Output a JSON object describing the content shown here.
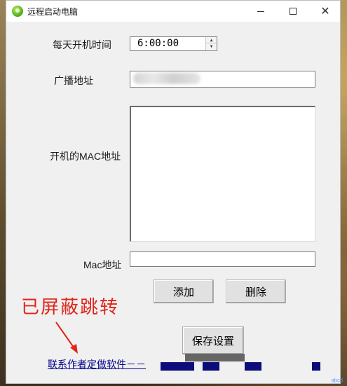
{
  "window": {
    "title": "远程启动电脑",
    "minimize_icon": "minimize-icon",
    "maximize_icon": "maximize-icon",
    "close_icon": "close-icon"
  },
  "form": {
    "daily_boot_time_label": "每天开机时间",
    "daily_boot_time_value": "6:00:00",
    "broadcast_label": "广播地址",
    "broadcast_value": "",
    "mac_list_label": "开机的MAC地址",
    "mac_input_label": "Mac地址",
    "mac_input_value": ""
  },
  "buttons": {
    "add": "添加",
    "delete": "删除",
    "save": "保存设置"
  },
  "footer": {
    "link_text": "联系作者定做软件－－",
    "overlay_notice": "已屏蔽跳转",
    "corner_text": "ᵃᵇᶜᵈ"
  },
  "colors": {
    "overlay_red": "#e0251b",
    "link_blue": "#00008b",
    "redaction_blue": "#0c0c7a"
  }
}
